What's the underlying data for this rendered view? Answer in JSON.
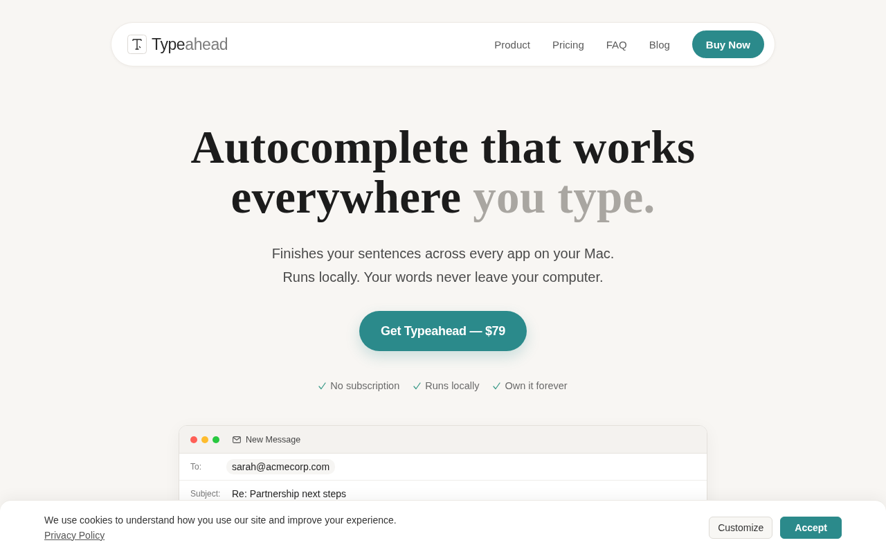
{
  "nav": {
    "logo": [
      {
        "text": "Type",
        "muted": false
      },
      {
        "text": "ahead",
        "muted": true
      }
    ],
    "links": [
      "Product",
      "Pricing",
      "FAQ",
      "Blog"
    ],
    "cta": "Buy Now"
  },
  "hero": {
    "headline": {
      "lines": [
        [
          {
            "text": "Autocomplete that works",
            "muted": false
          }
        ],
        [
          {
            "text": "everywhere",
            "muted": false
          },
          {
            "text": "you type.",
            "muted": true
          }
        ]
      ]
    },
    "subtitle": {
      "lines": [
        "Finishes your sentences across every app on your Mac.",
        "Runs locally. Your words never leave your computer."
      ]
    },
    "cta": "Get Typeahead — $79",
    "features": [
      "No subscription",
      "Runs locally",
      "Own it forever"
    ]
  },
  "email_window": {
    "title": "New Message",
    "fields": [
      {
        "kind": "chip",
        "label": "To:",
        "value": "sarah@acmecorp.com"
      },
      {
        "kind": "text",
        "label": "Subject:",
        "value": "Re: Partnership next steps"
      }
    ]
  },
  "cookie_banner": {
    "message": "We use cookies to understand how you use our site and improve your experience.",
    "link": "Privacy Policy",
    "buttons": [
      {
        "label": "Customize",
        "kind": "secondary"
      },
      {
        "label": "Accept",
        "kind": "primary"
      }
    ]
  }
}
